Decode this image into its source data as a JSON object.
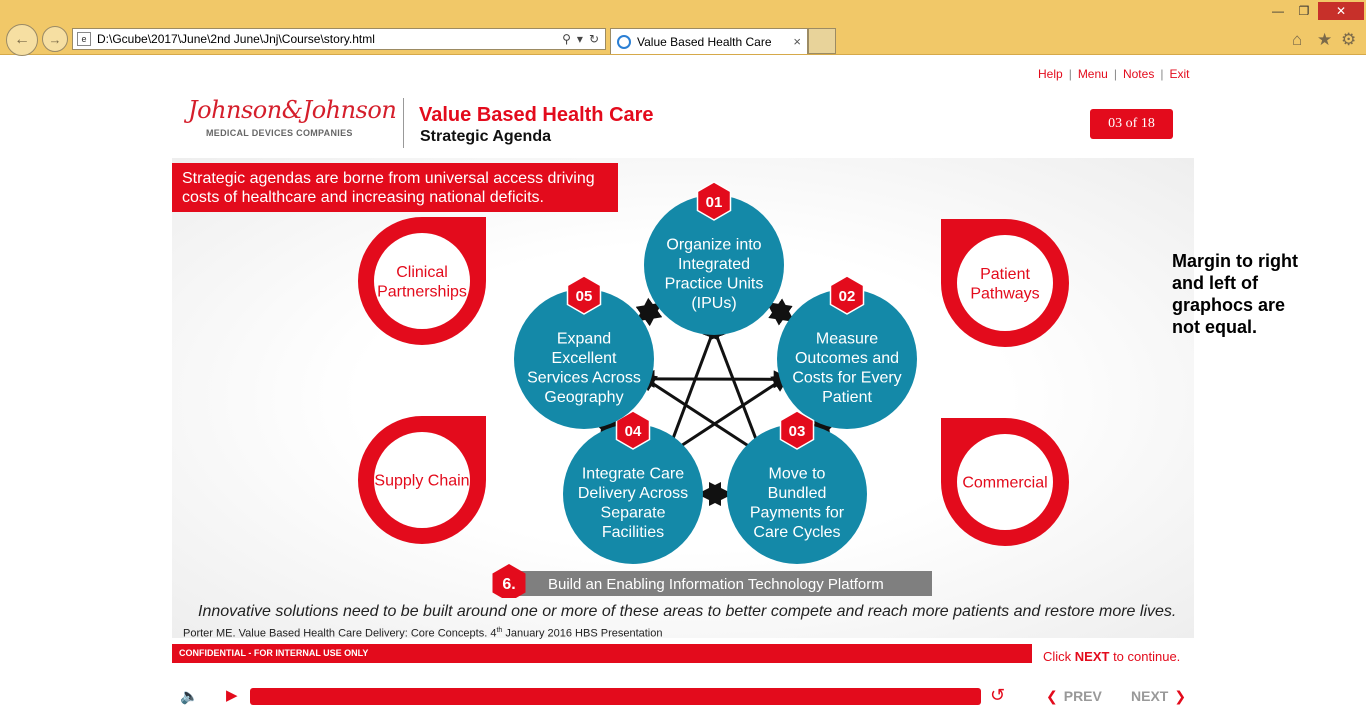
{
  "browser": {
    "url": "D:\\Gcube\\2017\\June\\2nd June\\Jnj\\Course\\story.html",
    "tab_title": "Value Based Health Care",
    "tab_close": "×"
  },
  "top_nav": {
    "help": "Help",
    "menu": "Menu",
    "notes": "Notes",
    "exit": "Exit"
  },
  "logo": {
    "script": "Johnson&Johnson",
    "subtitle": "MEDICAL DEVICES COMPANIES"
  },
  "header": {
    "title": "Value Based Health Care",
    "subtitle": "Strategic Agenda",
    "page_counter": "03 of 18"
  },
  "intro": "Strategic agendas are borne from universal access driving costs of healthcare and increasing national deficits.",
  "agenda": [
    {
      "num": "01",
      "lines": [
        "Organize into",
        "Integrated",
        "Practice Units",
        "(IPUs)"
      ]
    },
    {
      "num": "02",
      "lines": [
        "Measure",
        "Outcomes and",
        "Costs for Every",
        "Patient"
      ]
    },
    {
      "num": "03",
      "lines": [
        "Move to",
        "Bundled",
        "Payments for",
        "Care Cycles"
      ]
    },
    {
      "num": "04",
      "lines": [
        "Integrate Care",
        "Delivery Across",
        "Separate",
        "Facilities"
      ]
    },
    {
      "num": "05",
      "lines": [
        "Expand",
        "Excellent",
        "Services Across",
        "Geography"
      ]
    }
  ],
  "side_topics": {
    "top_left": [
      "Clinical",
      "Partnerships"
    ],
    "bottom_left": [
      "Supply Chain"
    ],
    "top_right": [
      "Patient",
      "Pathways"
    ],
    "bottom_right": [
      "Commercial"
    ]
  },
  "platform": {
    "num": "6.",
    "label": "Build an Enabling Information Technology Platform"
  },
  "note": "Margin to right and left of graphocs are not equal.",
  "footer": {
    "quote": "Innovative solutions need to be built around one or more of these areas to better compete and reach more patients and restore more lives.",
    "citation_pre": "Porter ME. Value Based Health Care Delivery: Core Concepts. 4",
    "citation_sup": "th",
    "citation_post": " January 2016 HBS Presentation",
    "confidential": "CONFIDENTIAL - FOR INTERNAL USE ONLY",
    "continue_pre": "Click ",
    "continue_next": "NEXT",
    "continue_post": " to continue."
  },
  "player": {
    "progress": 1.0,
    "prev": "PREV",
    "next": "NEXT"
  },
  "colors": {
    "brand_red": "#e30b1c",
    "circle_teal": "#1489a8",
    "platform_gray": "#7f7f7f"
  }
}
